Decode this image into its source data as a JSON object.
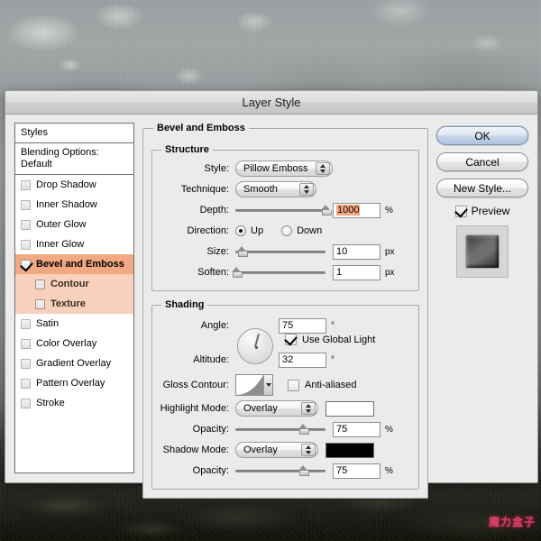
{
  "window": {
    "title": "Layer Style"
  },
  "watermark": {
    "text": "魔力盒子"
  },
  "styles_panel": {
    "header": "Styles",
    "blending_options": "Blending Options: Default",
    "items": [
      {
        "label": "Drop Shadow",
        "checked": false,
        "selected": false,
        "sub": false
      },
      {
        "label": "Inner Shadow",
        "checked": false,
        "selected": false,
        "sub": false
      },
      {
        "label": "Outer Glow",
        "checked": false,
        "selected": false,
        "sub": false
      },
      {
        "label": "Inner Glow",
        "checked": false,
        "selected": false,
        "sub": false
      },
      {
        "label": "Bevel and Emboss",
        "checked": true,
        "selected": true,
        "sub": false
      },
      {
        "label": "Contour",
        "checked": false,
        "selected": false,
        "sub": true
      },
      {
        "label": "Texture",
        "checked": false,
        "selected": false,
        "sub": true
      },
      {
        "label": "Satin",
        "checked": false,
        "selected": false,
        "sub": false
      },
      {
        "label": "Color Overlay",
        "checked": false,
        "selected": false,
        "sub": false
      },
      {
        "label": "Gradient Overlay",
        "checked": false,
        "selected": false,
        "sub": false
      },
      {
        "label": "Pattern Overlay",
        "checked": false,
        "selected": false,
        "sub": false
      },
      {
        "label": "Stroke",
        "checked": false,
        "selected": false,
        "sub": false
      }
    ]
  },
  "bevel_panel": {
    "legend": "Bevel and Emboss",
    "structure": {
      "legend": "Structure",
      "style_label": "Style:",
      "style_value": "Pillow Emboss",
      "technique_label": "Technique:",
      "technique_value": "Smooth",
      "depth_label": "Depth:",
      "depth_value": "1000",
      "depth_unit": "%",
      "direction_label": "Direction:",
      "direction_up": "Up",
      "direction_down": "Down",
      "size_label": "Size:",
      "size_value": "10",
      "size_unit": "px",
      "soften_label": "Soften:",
      "soften_value": "1",
      "soften_unit": "px"
    },
    "shading": {
      "legend": "Shading",
      "angle_label": "Angle:",
      "angle_value": "75",
      "angle_unit": "°",
      "use_global_light": "Use Global Light",
      "altitude_label": "Altitude:",
      "altitude_value": "32",
      "altitude_unit": "°",
      "gloss_contour_label": "Gloss Contour:",
      "anti_aliased": "Anti-aliased",
      "highlight_mode_label": "Highlight Mode:",
      "highlight_mode_value": "Overlay",
      "highlight_color": "#ffffff",
      "highlight_opacity_label": "Opacity:",
      "highlight_opacity_value": "75",
      "highlight_opacity_unit": "%",
      "shadow_mode_label": "Shadow Mode:",
      "shadow_mode_value": "Overlay",
      "shadow_color": "#000000",
      "shadow_opacity_label": "Opacity:",
      "shadow_opacity_value": "75",
      "shadow_opacity_unit": "%"
    }
  },
  "buttons": {
    "ok": "OK",
    "cancel": "Cancel",
    "new_style": "New Style...",
    "preview": "Preview"
  },
  "accent": {
    "selection": "#f2a882",
    "sub_selection": "#f7d1bb"
  }
}
